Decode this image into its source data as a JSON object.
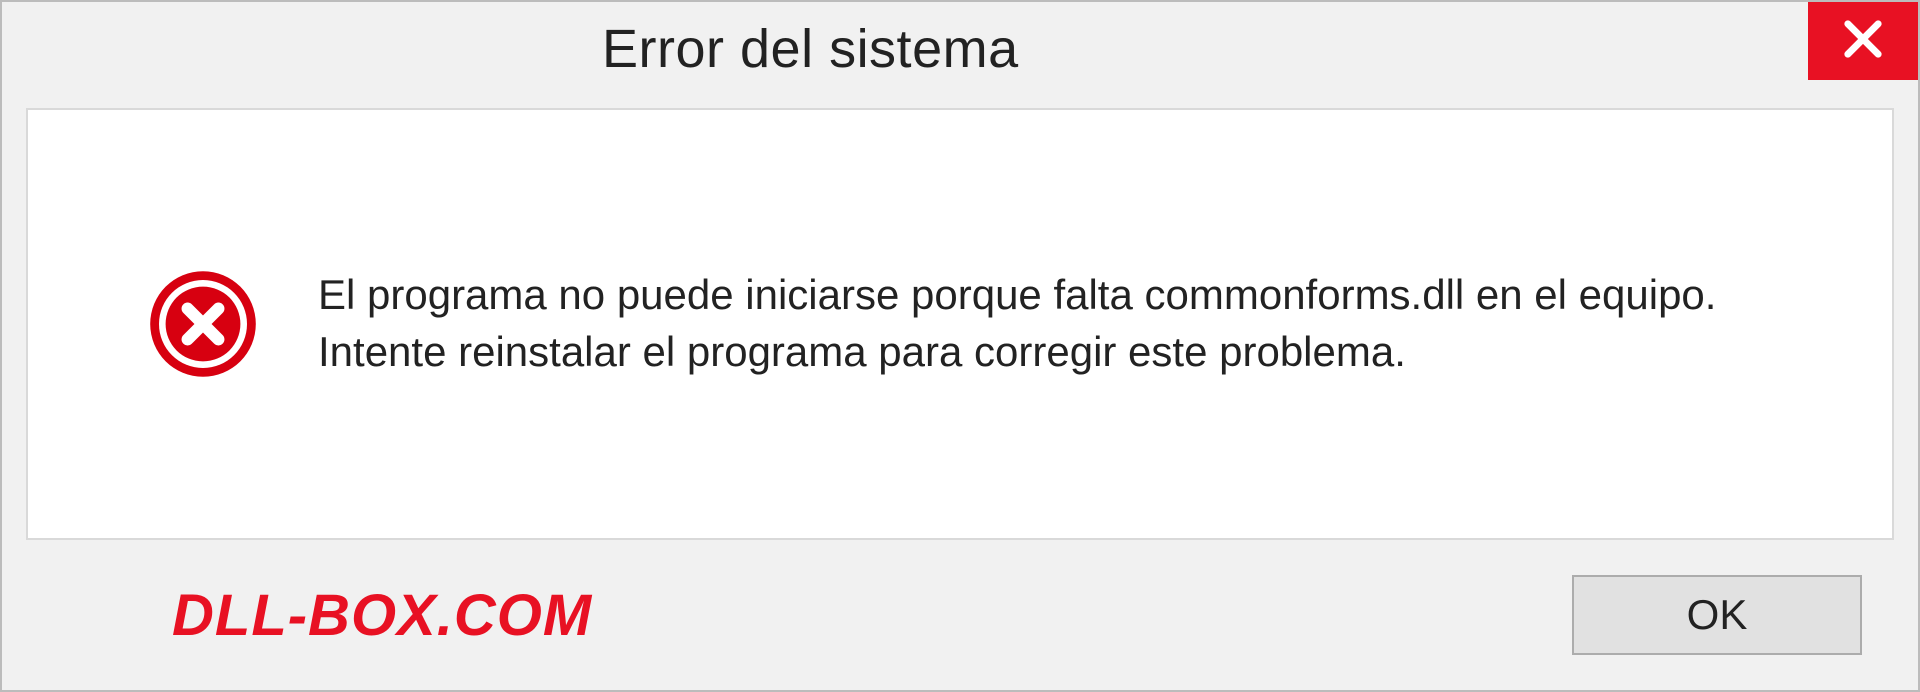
{
  "dialog": {
    "title": "Error del sistema",
    "message": "El programa no puede iniciarse porque falta commonforms.dll en el equipo. Intente reinstalar el programa para corregir este problema.",
    "ok_label": "OK"
  },
  "watermark": "DLL-BOX.COM",
  "colors": {
    "close_red": "#e81123",
    "error_red": "#d70010"
  }
}
